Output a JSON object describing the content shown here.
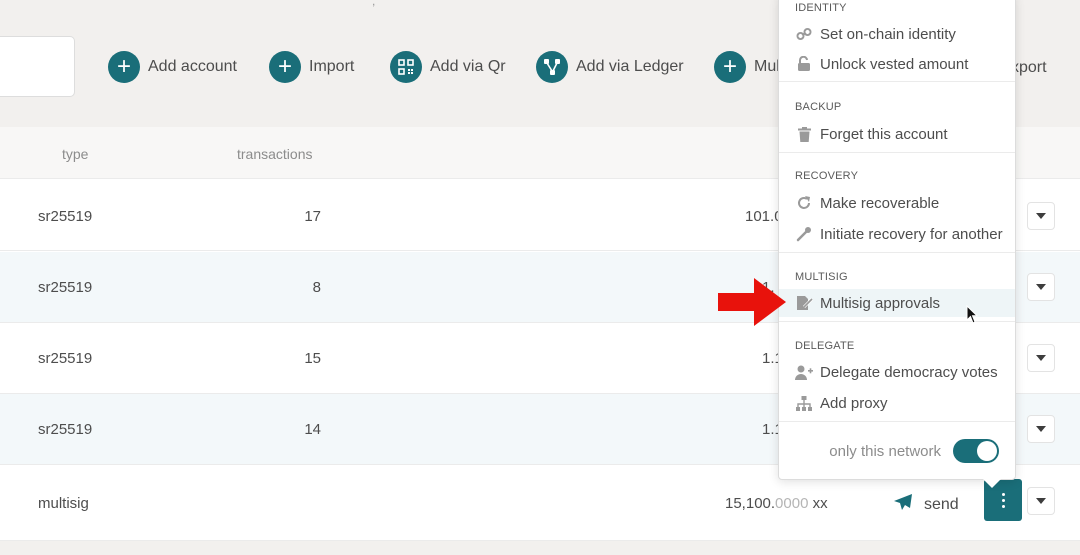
{
  "toolbar": {
    "add_account": "Add account",
    "import": "Import",
    "add_via_qr": "Add via Qr",
    "add_via_ledger": "Add via Ledger",
    "multisig_partial": "Mul",
    "export_partial": "xport"
  },
  "table": {
    "headers": {
      "type": "type",
      "transactions": "transactions"
    },
    "rows": [
      {
        "type": "sr25519",
        "transactions": "17",
        "balance_main": "101.0",
        "balance_faded": ""
      },
      {
        "type": "sr25519",
        "transactions": "8",
        "balance_main": "1.",
        "balance_faded": ""
      },
      {
        "type": "sr25519",
        "transactions": "15",
        "balance_main": "1.1",
        "balance_faded": ""
      },
      {
        "type": "sr25519",
        "transactions": "14",
        "balance_main": "1.1",
        "balance_faded": ""
      },
      {
        "type": "multisig",
        "transactions": "",
        "balance_main": "15,100.",
        "balance_faded": "0000",
        "balance_unit": " xx",
        "send_label": "send"
      }
    ]
  },
  "menu": {
    "sections": {
      "identity": "IDENTITY",
      "backup": "BACKUP",
      "recovery": "RECOVERY",
      "multisig": "MULTISIG",
      "delegate": "DELEGATE"
    },
    "items": {
      "set_identity": "Set on-chain identity",
      "unlock_vested": "Unlock vested amount",
      "forget_account": "Forget this account",
      "make_recoverable": "Make recoverable",
      "initiate_recovery": "Initiate recovery for another",
      "multisig_approvals": "Multisig approvals",
      "delegate_votes": "Delegate democracy votes",
      "add_proxy": "Add proxy"
    },
    "toggle_label": "only this network",
    "toggle_on": true
  },
  "colors": {
    "accent": "#1a6e79",
    "arrow": "#e8120c",
    "alt_row": "#f3f8fa",
    "page_bg": "#f2f0ee"
  }
}
